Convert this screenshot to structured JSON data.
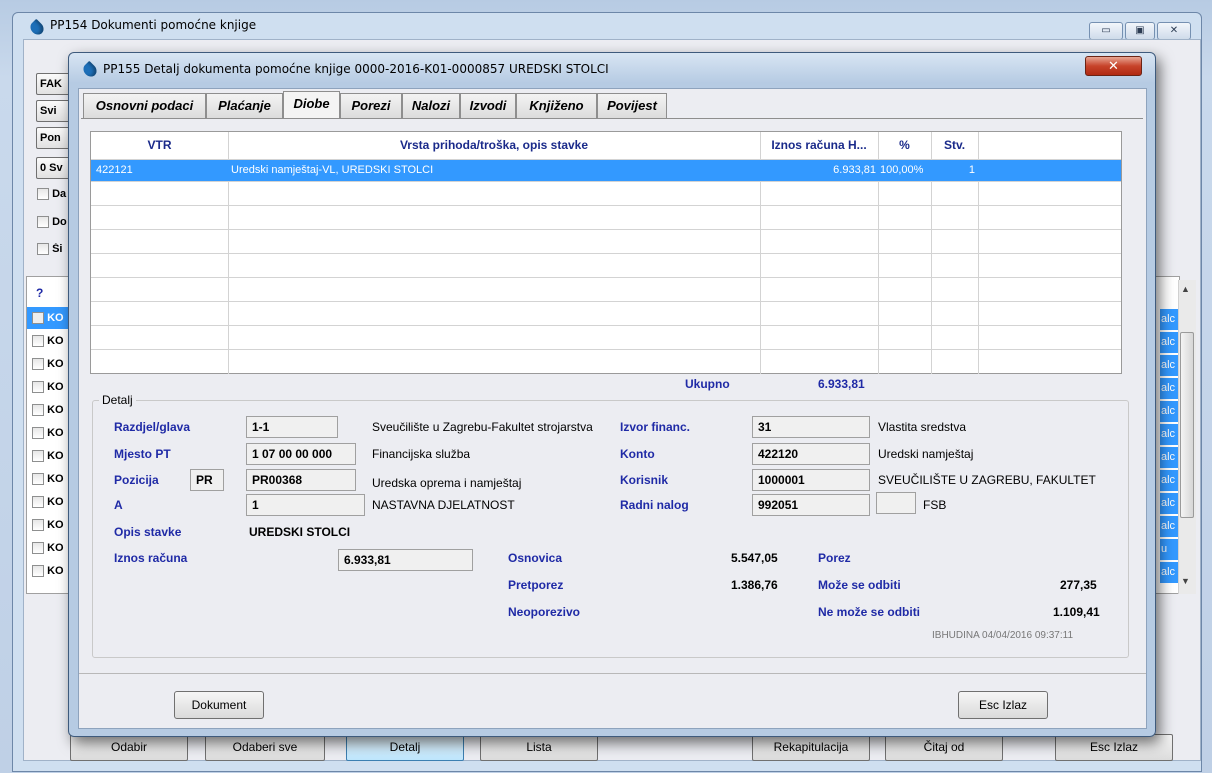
{
  "main_window": {
    "title": "PP154 Dokumenti pomoćne knjige",
    "left_buttons": [
      "FAK",
      "Svi",
      "Pon",
      "0 Sv"
    ],
    "left_checks": [
      "Da",
      "Do",
      "Ši"
    ],
    "list_header_mark": "?",
    "list_rows": [
      "KO",
      "KO",
      "KO",
      "KO",
      "KO",
      "KO",
      "KO",
      "KO",
      "KO",
      "KO",
      "KO",
      "KO"
    ],
    "right_tags": [
      "alc",
      "alc",
      "alc",
      "alc",
      "alc",
      "alc",
      "alc",
      "alc",
      "alc",
      "alc",
      "u",
      "alc"
    ],
    "bottom_buttons": [
      "Odabir",
      "Odaberi sve",
      "Detalj",
      "Lista",
      "Rekapitulacija",
      "Čitaj od",
      "Esc Izlaz"
    ],
    "caption_buttons": {
      "minimize": "▭",
      "restore": "▣",
      "close": "✕"
    }
  },
  "dialog": {
    "title": "PP155 Detalj dokumenta pomoćne knjige 0000-2016-K01-0000857 UREDSKI STOLCI",
    "close": "✕",
    "tabs": [
      "Osnovni podaci",
      "Plaćanje",
      "Diobe",
      "Porezi",
      "Nalozi",
      "Izvodi",
      "Knjiženo",
      "Povijest"
    ],
    "active_tab": "Diobe",
    "grid": {
      "headers": [
        "VTR",
        "Vrsta prihoda/troška, opis stavke",
        "Iznos računa H...",
        "%",
        "Stv."
      ],
      "rows": [
        {
          "vtr": "422121",
          "opis": "Uredski namještaj-VL, UREDSKI STOLCI",
          "iznos": "6.933,81",
          "pct": "100,00%",
          "stv": "1"
        }
      ]
    },
    "ukupno_label": "Ukupno",
    "ukupno_value": "6.933,81",
    "detalj": {
      "legend": "Detalj",
      "razdjel_label": "Razdjel/glava",
      "razdjel_value": "1-1",
      "razdjel_text": "Sveučilište u Zagrebu-Fakultet strojarstva",
      "mjesto_label": "Mjesto PT",
      "mjesto_value": "1 07 00 00 000",
      "mjesto_text": "Financijska služba",
      "pozicija_label": "Pozicija",
      "pozicija_prefix": "PR",
      "pozicija_value": "PR00368",
      "pozicija_text": "Uredska oprema i namještaj",
      "a_label": "A",
      "a_value": "1",
      "a_text": "NASTAVNA DJELATNOST",
      "opis_label": "Opis stavke",
      "opis_value": "UREDSKI STOLCI",
      "iznos_label": "Iznos računa",
      "iznos_value": "6.933,81",
      "izvor_label": "Izvor financ.",
      "izvor_value": "31",
      "izvor_text": "Vlastita sredstva",
      "konto_label": "Konto",
      "konto_value": "422120",
      "konto_text": "Uredski namještaj",
      "korisnik_label": "Korisnik",
      "korisnik_value": "1000001",
      "korisnik_text": "SVEUČILIŠTE U ZAGREBU, FAKULTET",
      "nalog_label": "Radni nalog",
      "nalog_value": "992051",
      "nalog_extra": "",
      "nalog_text": "FSB",
      "osnovica_label": "Osnovica",
      "osnovica_value": "5.547,05",
      "porez_label": "Porez",
      "pretporez_label": "Pretporez",
      "pretporez_value": "1.386,76",
      "odbiti_label": "Može se odbiti",
      "odbiti_value": "277,35",
      "neoporezivo_label": "Neoporezivo",
      "ne_odbiti_label": "Ne može se odbiti",
      "ne_odbiti_value": "1.109,41",
      "audit": "IBHUDINA 04/04/2016 09:37:11"
    },
    "buttons": {
      "dokument": "Dokument",
      "izlaz": "Esc Izlaz"
    }
  }
}
